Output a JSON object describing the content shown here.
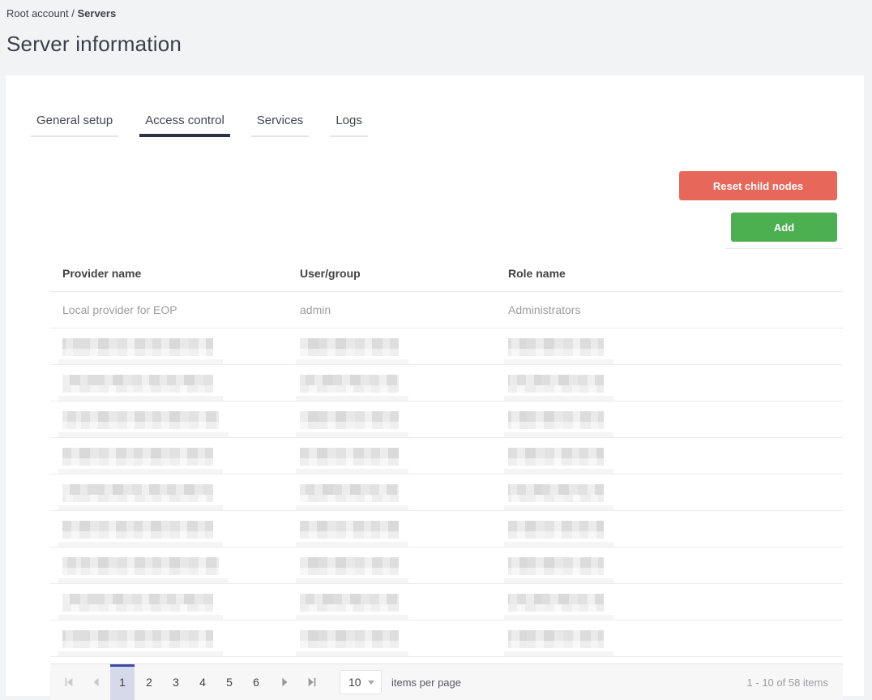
{
  "breadcrumb": {
    "root": "Root account",
    "separator": "/",
    "current": "Servers"
  },
  "page": {
    "title": "Server information"
  },
  "tabs": [
    {
      "label": "General setup",
      "active": false
    },
    {
      "label": "Access control",
      "active": true
    },
    {
      "label": "Services",
      "active": false
    },
    {
      "label": "Logs",
      "active": false
    }
  ],
  "toolbar": {
    "reset_button_label": "Reset child nodes",
    "add_button_label": "Add"
  },
  "table": {
    "columns": [
      {
        "key": "provider",
        "label": "Provider name"
      },
      {
        "key": "user_group",
        "label": "User/group"
      },
      {
        "key": "role",
        "label": "Role name"
      }
    ],
    "rows": [
      {
        "redacted": false,
        "provider": "Local provider for EOP",
        "user_group": "admin",
        "role": "Administrators"
      },
      {
        "redacted": true
      },
      {
        "redacted": true
      },
      {
        "redacted": true
      },
      {
        "redacted": true
      },
      {
        "redacted": true
      },
      {
        "redacted": true
      },
      {
        "redacted": true
      },
      {
        "redacted": true
      },
      {
        "redacted": true
      }
    ]
  },
  "pager": {
    "nav_icons": [
      "first-page-icon",
      "previous-page-icon",
      "next-page-icon",
      "last-page-icon"
    ],
    "pages": [
      "1",
      "2",
      "3",
      "4",
      "5",
      "6"
    ],
    "current_page": "1",
    "page_size": "10",
    "size_dropdown_icon": "chevron-down-icon",
    "items_per_page_label": "items per page",
    "range_label": "1 - 10 of 58 items"
  },
  "colors": {
    "accent_red": "#e7675a",
    "accent_green": "#4caf50",
    "active_tab_underline": "#2c3242",
    "pager_selected_border": "#3d4aa5",
    "pager_selected_bg": "#d6d9e9"
  }
}
